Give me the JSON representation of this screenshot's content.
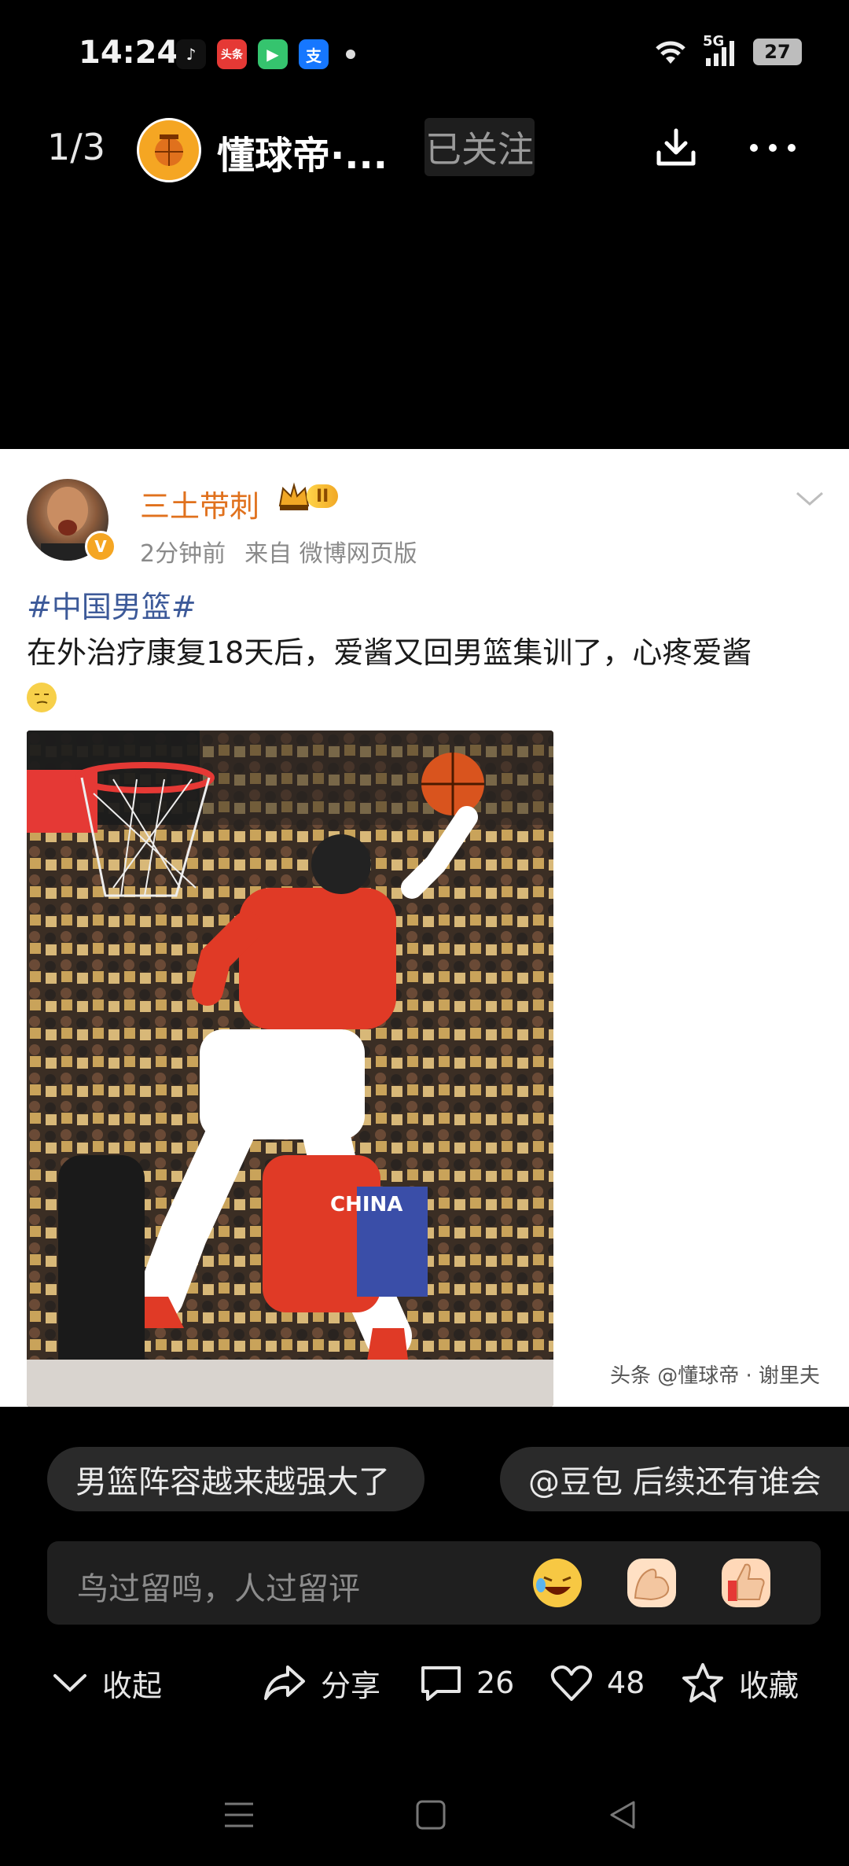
{
  "status_bar": {
    "time": "14:24",
    "notifications": [
      {
        "name": "tiktok-icon",
        "glyph": "♪",
        "color": "#111111"
      },
      {
        "name": "toutiao-icon",
        "glyph": "头条",
        "color": "#e53935"
      },
      {
        "name": "video-app-icon",
        "glyph": "▶",
        "color": "#35c46e"
      },
      {
        "name": "alipay-icon",
        "glyph": "支",
        "color": "#1677ff"
      }
    ],
    "network": "5G",
    "battery": "27"
  },
  "header": {
    "page_indicator": "1/3",
    "account_name": "懂球帝·...",
    "follow_label": "已关注"
  },
  "post": {
    "author": "三土带刺",
    "rank": "II",
    "time_ago": "2分钟前",
    "source": "来自 微博网页版",
    "topic": "#中国男篮#",
    "text": "在外治疗康复18天后，爱酱又回男篮集训了，心疼爱酱",
    "photo_desc_jersey": "CHINA",
    "watermark": "头条 @懂球帝 · 谢里夫"
  },
  "suggestions": [
    "男篮阵容越来越强大了",
    "@豆包 后续还有谁会"
  ],
  "comment_input": {
    "placeholder": "鸟过留鸣，人过留评"
  },
  "actions": {
    "collapse": "收起",
    "share": "分享",
    "comments": "26",
    "likes": "48",
    "favorite": "收藏"
  }
}
